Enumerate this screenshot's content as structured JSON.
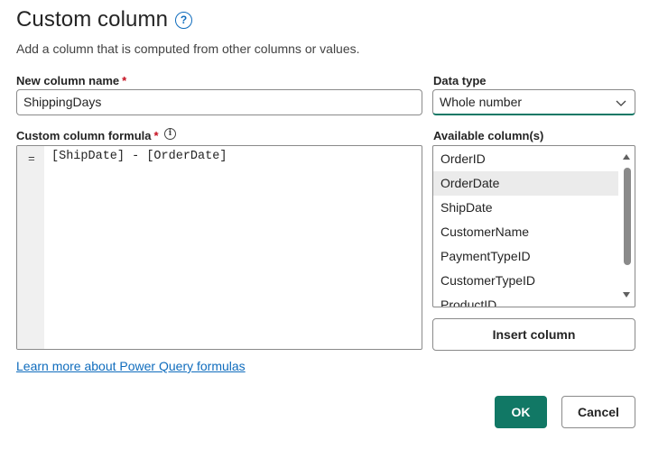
{
  "dialog": {
    "title": "Custom column",
    "subtitle": "Add a column that is computed from other columns or values.",
    "help_icon": "question-circle-icon"
  },
  "new_column": {
    "label": "New column name",
    "required_marker": "*",
    "value": "ShippingDays"
  },
  "data_type": {
    "label": "Data type",
    "selected": "Whole number",
    "icon": "chevron-down-icon"
  },
  "formula": {
    "label": "Custom column formula",
    "required_marker": "*",
    "info_icon": "info-icon",
    "gutter_symbol": "=",
    "value": "[ShipDate] - [OrderDate]"
  },
  "available_columns": {
    "label": "Available column(s)",
    "selected": "OrderDate",
    "items": [
      "OrderID",
      "OrderDate",
      "ShipDate",
      "CustomerName",
      "PaymentTypeID",
      "CustomerTypeID",
      "ProductID"
    ]
  },
  "buttons": {
    "insert": "Insert column",
    "ok": "OK",
    "cancel": "Cancel"
  },
  "link": {
    "learn_more": "Learn more about Power Query formulas"
  },
  "colors": {
    "accent": "#117865",
    "link": "#0f6cbd",
    "required": "#c50f1f",
    "selected_row": "#ebebeb"
  }
}
